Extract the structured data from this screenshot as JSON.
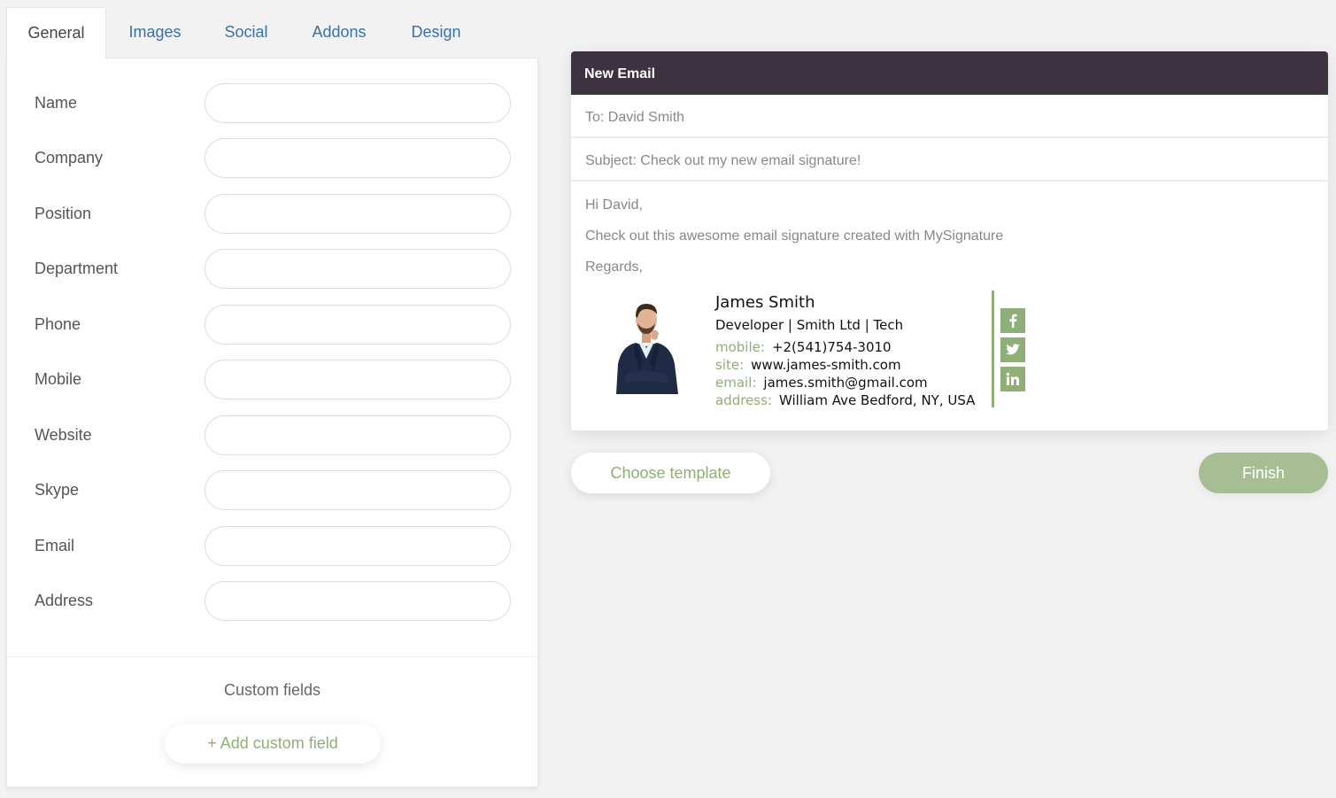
{
  "tabs": [
    "General",
    "Images",
    "Social",
    "Addons",
    "Design"
  ],
  "active_tab": "General",
  "form": {
    "fields": [
      {
        "label": "Name",
        "value": ""
      },
      {
        "label": "Company",
        "value": ""
      },
      {
        "label": "Position",
        "value": ""
      },
      {
        "label": "Department",
        "value": ""
      },
      {
        "label": "Phone",
        "value": ""
      },
      {
        "label": "Mobile",
        "value": ""
      },
      {
        "label": "Website",
        "value": ""
      },
      {
        "label": "Skype",
        "value": ""
      },
      {
        "label": "Email",
        "value": ""
      },
      {
        "label": "Address",
        "value": ""
      }
    ],
    "custom_fields_label": "Custom fields",
    "add_custom_field_label": "+ Add custom field"
  },
  "email": {
    "title": "New Email",
    "to": "To: David Smith",
    "subject": "Subject: Check out my new email signature!",
    "greeting": "Hi David,",
    "message": "Check out this awesome email signature created with MySignature",
    "closing": "Regards,"
  },
  "signature": {
    "name": "James Smith",
    "role": "Developer | Smith Ltd | Tech",
    "lines": [
      {
        "key": "mobile:",
        "value": "+2(541)754-3010"
      },
      {
        "key": "site:",
        "value": "www.james-smith.com"
      },
      {
        "key": "email:",
        "value": "james.smith@gmail.com"
      },
      {
        "key": "address:",
        "value": "William Ave Bedford, NY, USA"
      }
    ],
    "social_icons": [
      "facebook-icon",
      "twitter-icon",
      "linkedin-icon"
    ],
    "accent_color": "#8fae78"
  },
  "buttons": {
    "choose_template": "Choose template",
    "finish": "Finish"
  },
  "colors": {
    "header_bg": "#3d3340",
    "accent": "#8fae78",
    "finish_bg": "#a7bd93",
    "tab_link": "#3a72a8"
  }
}
